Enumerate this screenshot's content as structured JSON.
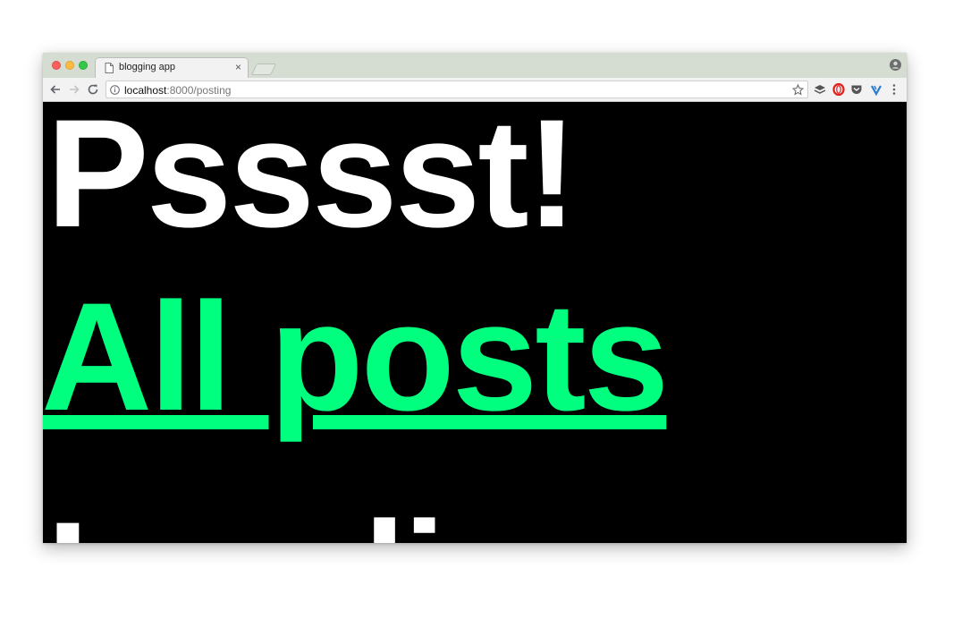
{
  "browser": {
    "tab": {
      "title": "blogging app",
      "close_glyph": "×",
      "favicon": "page-icon"
    },
    "address": {
      "host": "localhost",
      "rest": ":8000/posting"
    },
    "icons": {
      "back": "back-arrow-icon",
      "forward": "forward-arrow-icon",
      "reload": "reload-icon",
      "info": "info-icon",
      "bookmark": "star-icon",
      "extensions": [
        "layers-icon",
        "opera-icon",
        "pocket-icon",
        "v-extension-icon"
      ],
      "menu": "more-vertical-icon",
      "profile": "profile-icon"
    }
  },
  "page": {
    "headline": "Psssst!",
    "link": "All posts",
    "next_line_partial": "Loading",
    "colors": {
      "background": "#000000",
      "headline": "#ffffff",
      "link": "#00ff7f"
    }
  }
}
